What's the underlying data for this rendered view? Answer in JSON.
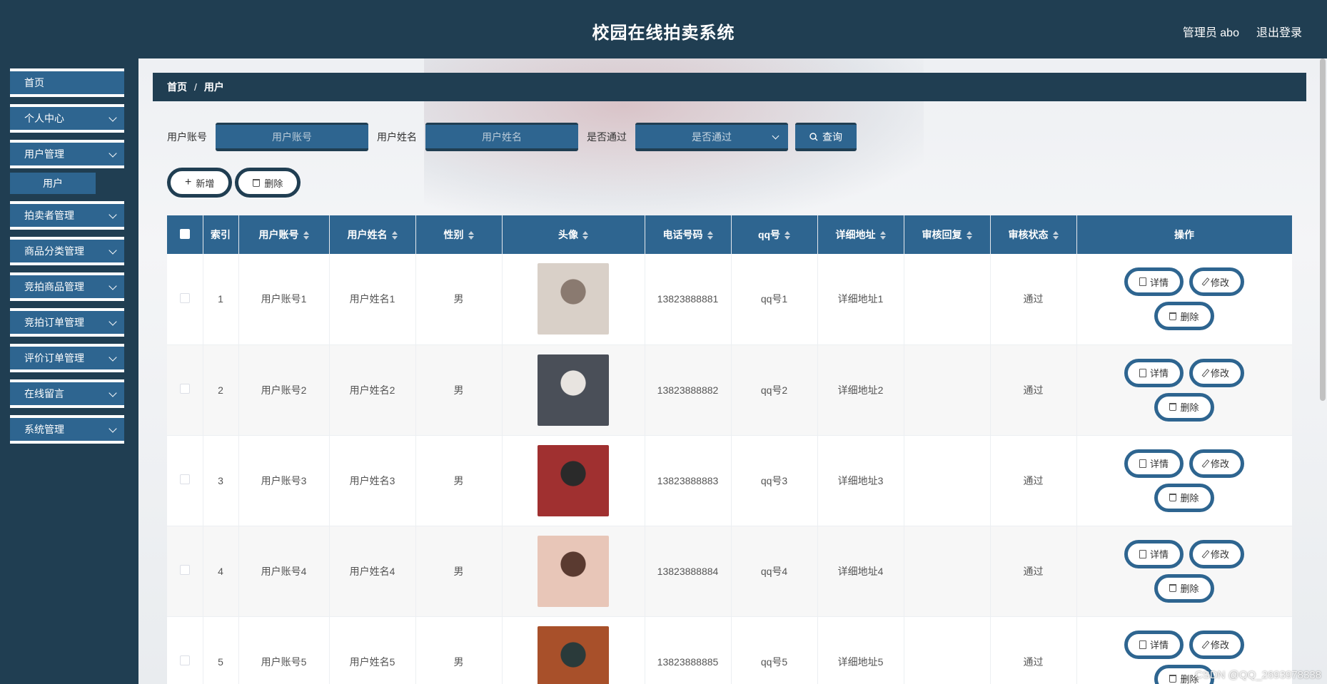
{
  "header": {
    "title": "校园在线拍卖系统",
    "user": "管理员 abo",
    "logout": "退出登录"
  },
  "sidebar": {
    "items": [
      {
        "label": "首页",
        "has_children": false
      },
      {
        "label": "个人中心",
        "has_children": true
      },
      {
        "label": "用户管理",
        "has_children": true,
        "children": [
          "用户"
        ]
      },
      {
        "label": "拍卖者管理",
        "has_children": true
      },
      {
        "label": "商品分类管理",
        "has_children": true
      },
      {
        "label": "竞拍商品管理",
        "has_children": true
      },
      {
        "label": "竞拍订单管理",
        "has_children": true
      },
      {
        "label": "评价订单管理",
        "has_children": true
      },
      {
        "label": "在线留言",
        "has_children": true
      },
      {
        "label": "系统管理",
        "has_children": true
      }
    ]
  },
  "breadcrumb": {
    "home": "首页",
    "sep": "/",
    "current": "用户"
  },
  "search": {
    "account_label": "用户账号",
    "account_placeholder": "用户账号",
    "name_label": "用户姓名",
    "name_placeholder": "用户姓名",
    "pass_label": "是否通过",
    "pass_placeholder": "是否通过",
    "query_label": "查询"
  },
  "actions": {
    "add": "新增",
    "delete": "删除"
  },
  "table": {
    "columns": [
      "索引",
      "用户账号",
      "用户姓名",
      "性别",
      "头像",
      "电话号码",
      "qq号",
      "详细地址",
      "审核回复",
      "审核状态",
      "操作"
    ],
    "rows": [
      {
        "index": "1",
        "account": "用户账号1",
        "name": "用户姓名1",
        "gender": "男",
        "phone": "13823888881",
        "qq": "qq号1",
        "address": "详细地址1",
        "reply": "",
        "status": "通过"
      },
      {
        "index": "2",
        "account": "用户账号2",
        "name": "用户姓名2",
        "gender": "男",
        "phone": "13823888882",
        "qq": "qq号2",
        "address": "详细地址2",
        "reply": "",
        "status": "通过"
      },
      {
        "index": "3",
        "account": "用户账号3",
        "name": "用户姓名3",
        "gender": "男",
        "phone": "13823888883",
        "qq": "qq号3",
        "address": "详细地址3",
        "reply": "",
        "status": "通过"
      },
      {
        "index": "4",
        "account": "用户账号4",
        "name": "用户姓名4",
        "gender": "男",
        "phone": "13823888884",
        "qq": "qq号4",
        "address": "详细地址4",
        "reply": "",
        "status": "通过"
      },
      {
        "index": "5",
        "account": "用户账号5",
        "name": "用户姓名5",
        "gender": "男",
        "phone": "13823888885",
        "qq": "qq号5",
        "address": "详细地址5",
        "reply": "",
        "status": "通过"
      }
    ],
    "row_actions": {
      "detail": "详情",
      "edit": "修改",
      "delete": "删除"
    }
  },
  "watermark": "CSDN @QQ_2693978338",
  "colors": {
    "header_bg": "#203e52",
    "accent": "#2e6590"
  }
}
